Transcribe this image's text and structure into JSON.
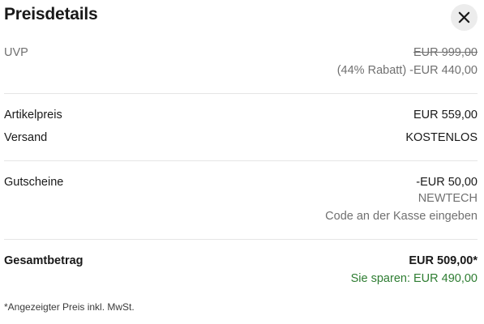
{
  "header": {
    "title": "Preisdetails",
    "close_icon": "close-icon"
  },
  "uvp": {
    "label": "UVP",
    "original_price": "EUR 999,00",
    "discount": "(44% Rabatt) -EUR 440,00"
  },
  "item": {
    "label": "Artikelpreis",
    "value": "EUR 559,00"
  },
  "shipping": {
    "label": "Versand",
    "value": "KOSTENLOS"
  },
  "coupons": {
    "label": "Gutscheine",
    "value": "-EUR 50,00",
    "code": "NEWTECH",
    "hint": "Code an der Kasse eingeben"
  },
  "total": {
    "label": "Gesamtbetrag",
    "value": "EUR 509,00*",
    "savings": "Sie sparen: EUR 490,00"
  },
  "footnote": "*Angezeigter Preis inkl. MwSt.",
  "colors": {
    "savings_green": "#2e7d32",
    "muted_text": "#707070",
    "divider": "#e5e5e5"
  }
}
